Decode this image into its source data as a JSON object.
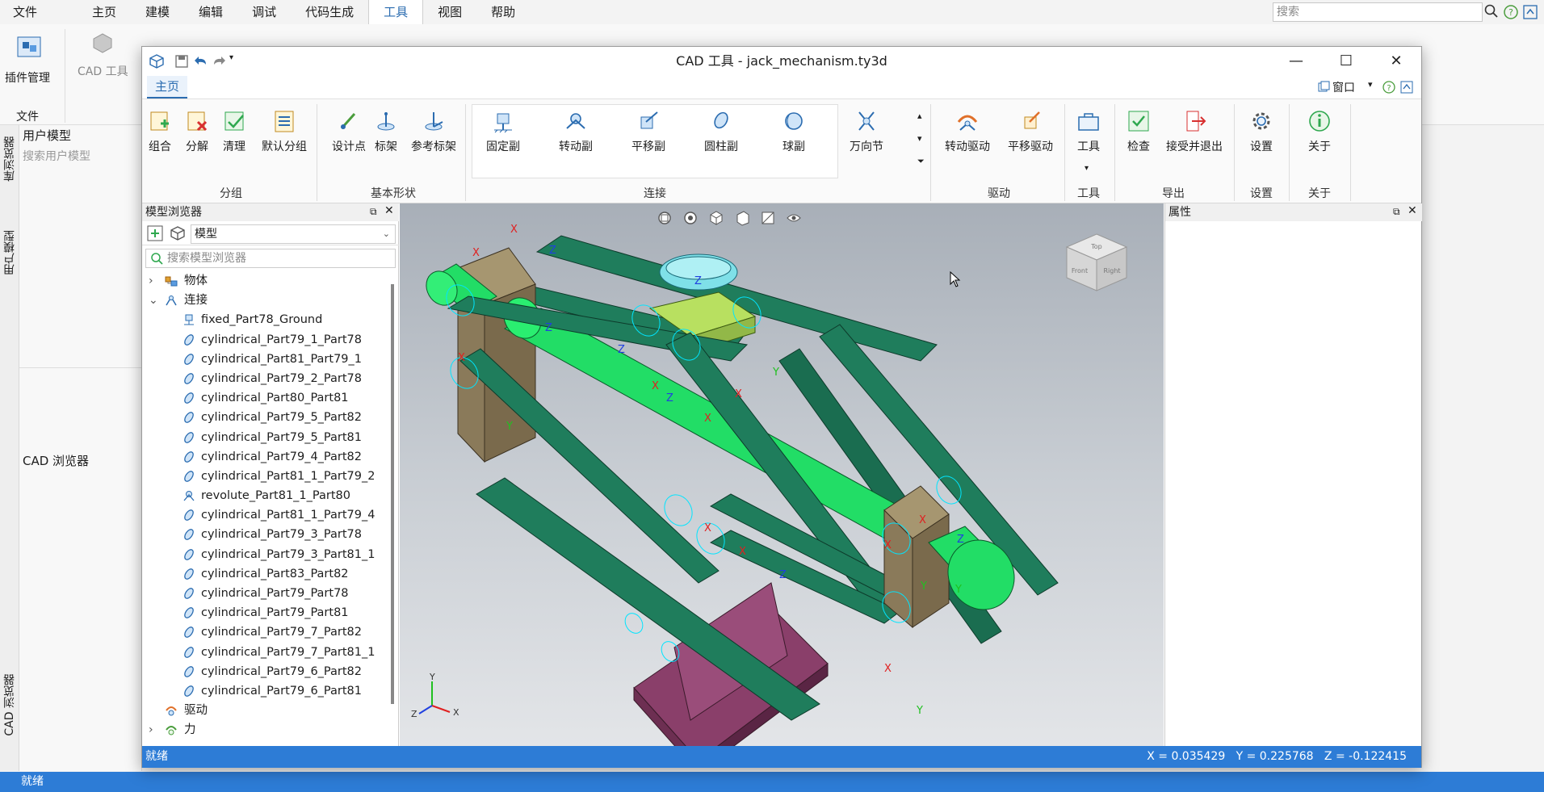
{
  "bg_app": {
    "menu": [
      "文件",
      "主页",
      "建模",
      "编辑",
      "调试",
      "代码生成",
      "工具",
      "视图",
      "帮助"
    ],
    "active_menu": "工具",
    "search_placeholder": "搜索",
    "ribbon_plugin_label": "插件管理",
    "ribbon_cad_label": "CAD 工具",
    "ribbon_file_group": "文件",
    "left_strip_labels": [
      "库浏览器",
      "用户模型",
      "CAD 浏览器"
    ],
    "user_model_title": "用户模型",
    "user_model_search": "搜索用户模型",
    "cad_browser_title": "CAD 浏览器",
    "status": "就绪"
  },
  "window": {
    "title": "CAD 工具 - jack_mechanism.ty3d",
    "tab": "主页",
    "window_menu": "窗口"
  },
  "ribbon": {
    "group_grouping": {
      "label": "分组",
      "buttons": [
        "组合",
        "分解",
        "清理",
        "默认分组"
      ]
    },
    "group_shapes": {
      "label": "基本形状",
      "buttons": [
        "设计点",
        "标架",
        "参考标架"
      ]
    },
    "group_joints": {
      "label": "连接",
      "buttons": [
        "固定副",
        "转动副",
        "平移副",
        "圆柱副",
        "球副",
        "万向节"
      ]
    },
    "group_drive": {
      "label": "驱动",
      "buttons": [
        "转动驱动",
        "平移驱动"
      ]
    },
    "group_tools": {
      "label": "工具",
      "buttons": [
        "工具"
      ]
    },
    "group_export": {
      "label": "导出",
      "buttons": [
        "检查",
        "接受并退出"
      ]
    },
    "group_settings": {
      "label": "设置",
      "buttons": [
        "设置"
      ]
    },
    "group_about": {
      "label": "关于",
      "buttons": [
        "关于"
      ]
    }
  },
  "model_browser": {
    "title": "模型浏览器",
    "select_value": "模型",
    "search_placeholder": "搜索模型浏览器",
    "tree": [
      {
        "label": "物体",
        "level": 0,
        "expand": "collapsed"
      },
      {
        "label": "连接",
        "level": 0,
        "expand": "expanded"
      },
      {
        "label": "fixed_Part78_Ground",
        "level": 1,
        "kind": "fixed"
      },
      {
        "label": "cylindrical_Part79_1_Part78",
        "level": 1,
        "kind": "cyl"
      },
      {
        "label": "cylindrical_Part81_Part79_1",
        "level": 1,
        "kind": "cyl"
      },
      {
        "label": "cylindrical_Part79_2_Part78",
        "level": 1,
        "kind": "cyl"
      },
      {
        "label": "cylindrical_Part80_Part81",
        "level": 1,
        "kind": "cyl"
      },
      {
        "label": "cylindrical_Part79_5_Part82",
        "level": 1,
        "kind": "cyl"
      },
      {
        "label": "cylindrical_Part79_5_Part81",
        "level": 1,
        "kind": "cyl"
      },
      {
        "label": "cylindrical_Part79_4_Part82",
        "level": 1,
        "kind": "cyl"
      },
      {
        "label": "cylindrical_Part81_1_Part79_2",
        "level": 1,
        "kind": "cyl"
      },
      {
        "label": "revolute_Part81_1_Part80",
        "level": 1,
        "kind": "rev"
      },
      {
        "label": "cylindrical_Part81_1_Part79_4",
        "level": 1,
        "kind": "cyl"
      },
      {
        "label": "cylindrical_Part79_3_Part78",
        "level": 1,
        "kind": "cyl"
      },
      {
        "label": "cylindrical_Part79_3_Part81_1",
        "level": 1,
        "kind": "cyl"
      },
      {
        "label": "cylindrical_Part83_Part82",
        "level": 1,
        "kind": "cyl"
      },
      {
        "label": "cylindrical_Part79_Part78",
        "level": 1,
        "kind": "cyl"
      },
      {
        "label": "cylindrical_Part79_Part81",
        "level": 1,
        "kind": "cyl"
      },
      {
        "label": "cylindrical_Part79_7_Part82",
        "level": 1,
        "kind": "cyl"
      },
      {
        "label": "cylindrical_Part79_7_Part81_1",
        "level": 1,
        "kind": "cyl"
      },
      {
        "label": "cylindrical_Part79_6_Part82",
        "level": 1,
        "kind": "cyl"
      },
      {
        "label": "cylindrical_Part79_6_Part81",
        "level": 1,
        "kind": "cyl"
      },
      {
        "label": "驱动",
        "level": 0,
        "expand": "none"
      },
      {
        "label": "力",
        "level": 0,
        "expand": "collapsed"
      }
    ]
  },
  "viewport": {
    "cube_faces": [
      "Top",
      "Front",
      "Right"
    ],
    "axis_labels": {
      "x": "X",
      "y": "Y",
      "z": "Z"
    },
    "colors": {
      "links": "#1f7d5c",
      "rod": "#22dd66",
      "base": "#8a3f6a",
      "blocks": "#8a7a5a",
      "cup": "#7fe0e8",
      "frames": "#00e5ff"
    }
  },
  "properties": {
    "title": "属性"
  },
  "status": {
    "text": "就绪",
    "coords": "X = 0.035429   Y = 0.225768   Z = -0.122415"
  }
}
